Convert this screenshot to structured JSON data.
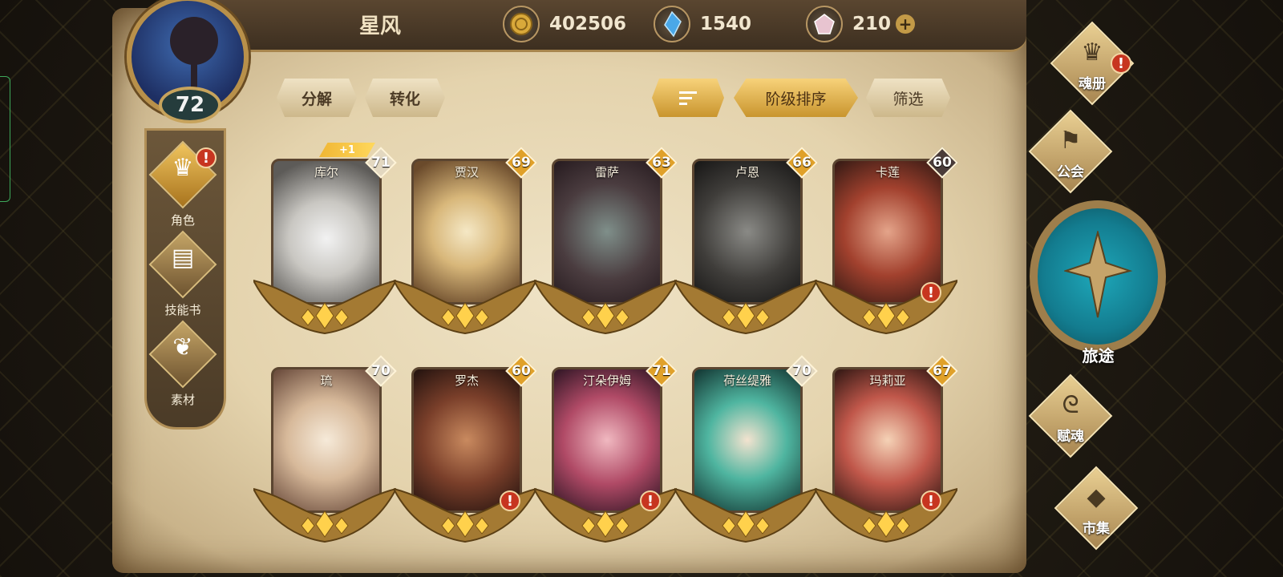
{
  "player": {
    "name": "星风",
    "level": "72"
  },
  "currencies": [
    {
      "icon": "gold-coin-icon",
      "value": "402506"
    },
    {
      "icon": "blue-crystal-icon",
      "value": "1540"
    },
    {
      "icon": "pink-gem-icon",
      "value": "210"
    }
  ],
  "left_nav": [
    {
      "label": "角色",
      "icon": "character-icon",
      "active": true,
      "alert": true
    },
    {
      "label": "技能书",
      "icon": "skill-book-icon",
      "active": false,
      "alert": false
    },
    {
      "label": "素材",
      "icon": "material-icon",
      "active": false,
      "alert": false
    }
  ],
  "toolbar": {
    "decompose": "分解",
    "convert": "转化",
    "sort_icon": "sort-icon",
    "sort_label": "阶级排序",
    "filter": "筛选"
  },
  "heroes": [
    {
      "name": "库尔",
      "level": "71",
      "bonus": "+1",
      "alert": false,
      "badge_color": "#e3d8c0"
    },
    {
      "name": "贾汉",
      "level": "69",
      "alert": false,
      "badge_color": "#e0a12a"
    },
    {
      "name": "雷萨",
      "level": "63",
      "alert": false,
      "badge_color": "#e0a12a"
    },
    {
      "name": "卢恩",
      "level": "66",
      "alert": false,
      "badge_color": "#e0a12a"
    },
    {
      "name": "卡莲",
      "level": "60",
      "alert": true,
      "badge_color": "#4a3c3a"
    },
    {
      "name": "琉",
      "level": "70",
      "alert": false,
      "badge_color": "#e3d8c0"
    },
    {
      "name": "罗杰",
      "level": "60",
      "alert": true,
      "badge_color": "#e0a12a"
    },
    {
      "name": "汀朵伊姆",
      "level": "71",
      "alert": true,
      "badge_color": "#e0a12a"
    },
    {
      "name": "荷丝缇雅",
      "level": "70",
      "alert": false,
      "badge_color": "#e3d8c0"
    },
    {
      "name": "玛莉亚",
      "level": "67",
      "alert": true,
      "badge_color": "#e0a12a"
    }
  ],
  "right_nav": [
    {
      "label": "魂册",
      "icon": "helmet-icon",
      "alert": true
    },
    {
      "label": "公会",
      "icon": "guild-banner-icon",
      "alert": false
    },
    {
      "label": "旅途",
      "icon": "compass-icon",
      "alert": false
    },
    {
      "label": "赋魂",
      "icon": "swirl-icon",
      "alert": false
    },
    {
      "label": "市集",
      "icon": "gem-market-icon",
      "alert": false
    }
  ],
  "colors": {
    "gold_accent": "#c99a3e",
    "alert_red": "#c73520",
    "parchment": "#e9dcbc",
    "teal": "#1ea7b9"
  }
}
